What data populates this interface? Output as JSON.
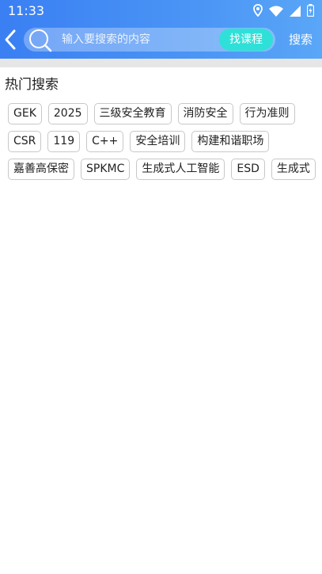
{
  "status_bar": {
    "time": "11:33",
    "icons": [
      "location-icon",
      "wifi-icon",
      "signal-icon",
      "battery-icon"
    ]
  },
  "header": {
    "search_placeholder": "输入要搜索的内容",
    "find_course_label": "找课程",
    "search_label": "搜索",
    "accent_color": "#3a7ff3",
    "find_course_color": "#2fe0d8"
  },
  "hot_search": {
    "title": "热门搜索",
    "tags": [
      "GEK",
      "2025",
      "三级安全教育",
      "消防安全",
      "行为准则",
      "CSR",
      "119",
      "C++",
      "安全培训",
      "构建和谐职场",
      "嘉善高保密",
      "SPKMC",
      "生成式人工智能",
      "ESD",
      "生成式"
    ]
  }
}
